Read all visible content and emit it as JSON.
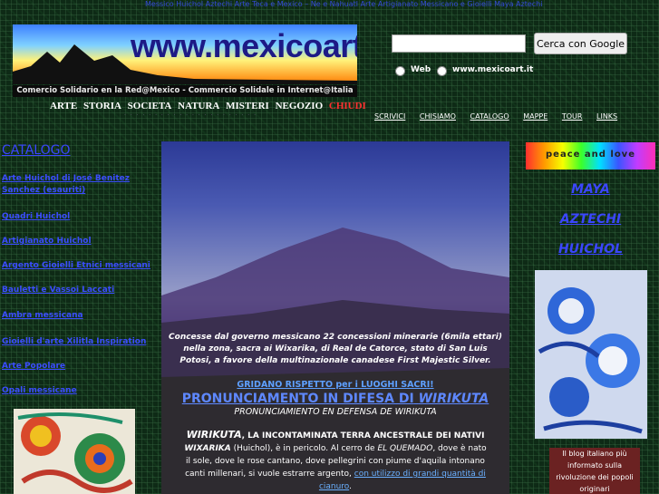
{
  "top_line": "Messico Huichol Aztechi Arte Teca e Mexico – Ne e Nahuatl Arte Artigianato Messicano e Gioielli Maya Aztechi",
  "banner": {
    "title": "www.mexicoart.it",
    "slogan": "Comercio Solidario en la Red@Mexico - Commercio Solidale in Internet@Italia"
  },
  "top_nav": [
    "ARTE",
    "STORIA",
    "SOCIETA",
    "NATURA",
    "MISTERI",
    "NEGOZIO"
  ],
  "top_nav_close": "CHIUDI",
  "search": {
    "value": "",
    "button": "Cerca con Google",
    "option_web": "Web",
    "option_site": "www.mexicoart.it"
  },
  "right_nav": [
    "SCRIVICI",
    "CHISIAMO",
    "CATALOGO",
    "MAPPE",
    "TOUR",
    "LINKS"
  ],
  "catalog": {
    "title": "CATALOGO",
    "items": [
      "Arte Huichol di José Benitez Sanchez (esauriti)",
      "Quadri Huichol",
      "Artigianato Huichol",
      "Argento Gioielli Etnici messicani",
      "Bauletti e Vassoi Laccati",
      "Ambra messicana",
      "Gioielli d'arte Xilitla Inspiration",
      "Arte Popolare",
      "Opali messicane"
    ]
  },
  "hero": {
    "concessions": "Concesse dal governo messicano 22 concessioni minerarie (6mila ettari) nella zona, sacra ai Wixarika, di Real de Catorce, stato di San Luis Potosi, a favore della multinazionale canadese First Majestic Silver.",
    "gridano": "GRIDANO RISPETTO per i LUOGHI SACRI!",
    "pronunciamento_main": "PRONUNCIAMENTO IN DIFESA DI",
    "pronunciamento_italic": "WIRIKUTA",
    "pronunciamento_es": "PRONUNCIAMIENTO EN DEFENSA DE WIRIKUTA",
    "wirikuta_title": "WIRIKUTA",
    "wirikuta_rest": ", LA INCONTAMINATA TERRA ANCESTRALE DEI NATIVI",
    "wixarika_bold": "WIXARIKA",
    "wixarika_text": " (Huichol), è in pericolo. Al cerro de ",
    "quemado": "EL QUEMADO",
    "wixarika_text2": ", dove è nato il sole, dove le rose cantano, dove pellegrini con piume d'aquila intonano canti millenari, si vuole estrarre argento, ",
    "cyanide_link": "con utilizzo di grandi quantità di cianuro",
    "end": "."
  },
  "right_panel": {
    "peace": "peace and love",
    "links": [
      "MAYA",
      "AZTECHI",
      "HUICHOL"
    ],
    "blog": "Il blog italiano più informato sulla rivoluzione dei popoli originari"
  }
}
